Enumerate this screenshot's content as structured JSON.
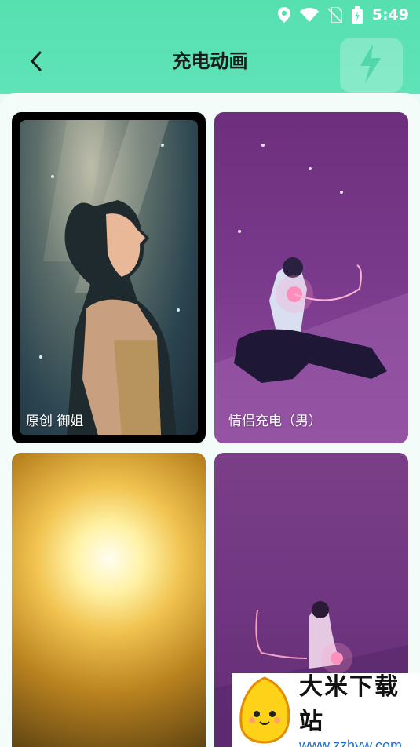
{
  "status_bar": {
    "time": "5:49",
    "icons": [
      "location-icon",
      "wifi-icon",
      "no-sim-icon",
      "battery-charging-icon"
    ]
  },
  "header": {
    "title": "充电动画",
    "back_icon": "chevron-left-icon"
  },
  "cards": [
    {
      "label": "原创 御姐",
      "theme_color": "#2b4450"
    },
    {
      "label": "情侣充电（男）",
      "theme_color": "#7a3a8c"
    },
    {
      "label": "",
      "theme_color": "#f1c350"
    },
    {
      "label": "",
      "theme_color": "#6f3580"
    }
  ],
  "watermark": {
    "title": "大米下载站",
    "url": "www.zzhyw.com"
  },
  "colors": {
    "header_bg": "#5fe3b8",
    "panel_bg": "#f3fcf8",
    "title_text": "#1b1b1b"
  }
}
